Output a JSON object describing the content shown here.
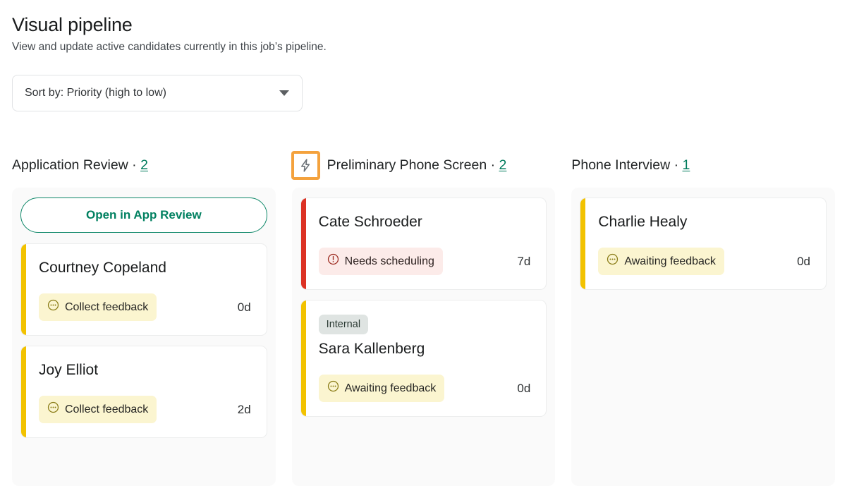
{
  "header": {
    "title": "Visual pipeline",
    "subtitle": "View and update active candidates currently in this job’s pipeline."
  },
  "sort": {
    "label": "Sort by: Priority (high to low)",
    "icon": "chevron-down-icon"
  },
  "colors": {
    "accent_green": "#008060",
    "count_link": "#007b5c",
    "bolt_border": "#f4a23d",
    "bar_yellow": "#f2c200",
    "bar_red": "#dc3224",
    "status_yellow_bg": "#fbf5d0",
    "status_red_bg": "#fcebe9",
    "tag_bg": "#dfe4e2",
    "column_bg": "#fafafa"
  },
  "columns": [
    {
      "title": "Application Review ·",
      "count": "2",
      "has_bolt": false,
      "action_label": "Open in App Review",
      "cards": [
        {
          "name": "Courtney Copeland",
          "tag": null,
          "status": "Collect feedback",
          "status_type": "yellow",
          "status_icon": "ellipsis-circle-icon",
          "age": "0d",
          "bar": "yellow"
        },
        {
          "name": "Joy Elliot",
          "tag": null,
          "status": "Collect feedback",
          "status_type": "yellow",
          "status_icon": "ellipsis-circle-icon",
          "age": "2d",
          "bar": "yellow"
        }
      ]
    },
    {
      "title": "Preliminary Phone Screen ·",
      "count": "2",
      "has_bolt": true,
      "bolt_icon": "lightning-bolt-icon",
      "action_label": null,
      "cards": [
        {
          "name": "Cate Schroeder",
          "tag": null,
          "status": "Needs scheduling",
          "status_type": "red",
          "status_icon": "exclamation-circle-icon",
          "age": "7d",
          "bar": "red"
        },
        {
          "name": "Sara Kallenberg",
          "tag": "Internal",
          "status": "Awaiting feedback",
          "status_type": "yellow",
          "status_icon": "ellipsis-circle-icon",
          "age": "0d",
          "bar": "yellow"
        }
      ]
    },
    {
      "title": "Phone Interview ·",
      "count": "1",
      "has_bolt": false,
      "action_label": null,
      "cards": [
        {
          "name": "Charlie Healy",
          "tag": null,
          "status": "Awaiting feedback",
          "status_type": "yellow",
          "status_icon": "ellipsis-circle-icon",
          "age": "0d",
          "bar": "yellow"
        }
      ]
    }
  ]
}
